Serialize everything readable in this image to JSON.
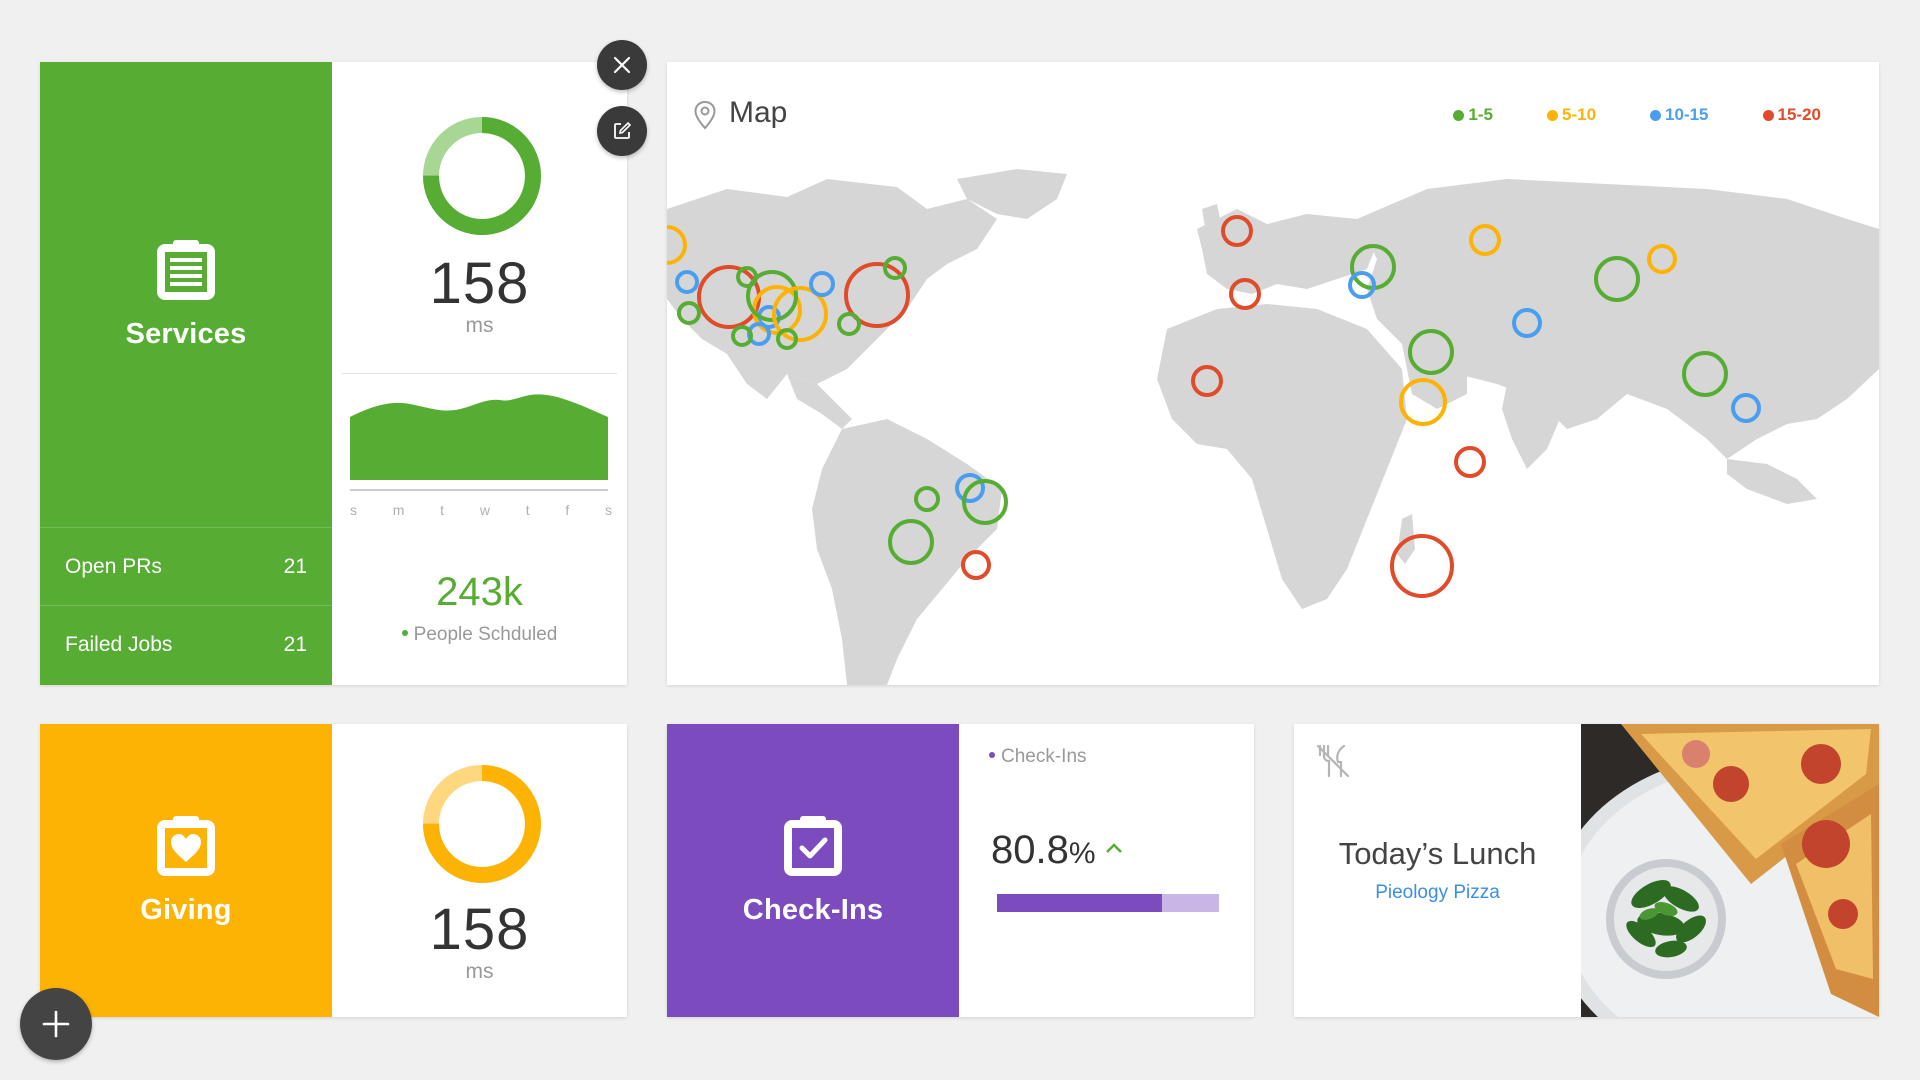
{
  "colors": {
    "green": "#57ad33",
    "yellow": "#fdb304",
    "purple": "#7c4bbd",
    "blue": "#3b8fe0",
    "red": "#e04b2a",
    "map_land": "#d6d6d6"
  },
  "services": {
    "title": "Services",
    "icon": "clipboard-list-icon",
    "stats": [
      {
        "label": "Open PRs",
        "value": "21"
      },
      {
        "label": "Failed Jobs",
        "value": "21"
      }
    ],
    "response_time": "158",
    "response_unit": "ms",
    "ring_fill_fraction": 0.75,
    "weekdays": [
      "s",
      "m",
      "t",
      "w",
      "t",
      "f",
      "s"
    ],
    "metric_value": "243k",
    "metric_label": "People Schduled"
  },
  "actions": {
    "close_icon": "close-icon",
    "edit_icon": "edit-icon",
    "add_icon": "plus-icon"
  },
  "map": {
    "title": "Map",
    "icon": "map-pin-icon",
    "legend": [
      {
        "label": "1-5",
        "color": "#57ad33"
      },
      {
        "label": "5-10",
        "color": "#fdb304"
      },
      {
        "label": "10-15",
        "color": "#4a9ef0"
      },
      {
        "label": "15-20",
        "color": "#e04b2a"
      }
    ]
  },
  "giving": {
    "title": "Giving",
    "icon": "heart-calendar-icon",
    "response_time": "158",
    "response_unit": "ms",
    "ring_fill_fraction": 0.75
  },
  "checkins": {
    "title": "Check-Ins",
    "icon": "check-calendar-icon",
    "label": "Check-Ins",
    "value": "80.8",
    "percent_sign": "%",
    "progress_fraction": 0.742,
    "trend": "up"
  },
  "lunch": {
    "icon": "utensils-off-icon",
    "title": "Today’s Lunch",
    "subtitle": "Pieology Pizza"
  }
}
